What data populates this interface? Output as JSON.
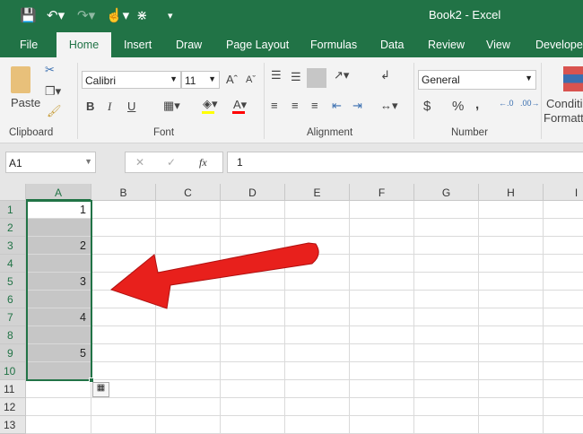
{
  "title": "Book2  -  Excel",
  "quick_access": {
    "save": "save-icon",
    "undo": "undo-icon",
    "redo": "redo-icon",
    "touch": "touch-mode-icon",
    "customize": "customize-icon"
  },
  "tabs": [
    "File",
    "Home",
    "Insert",
    "Draw",
    "Page Layout",
    "Formulas",
    "Data",
    "Review",
    "View",
    "Developer"
  ],
  "ribbon": {
    "paste": "Paste",
    "groups": [
      "Clipboard",
      "Font",
      "Alignment",
      "Number"
    ],
    "font_name": "Calibri",
    "font_size": "11",
    "number_format": "General",
    "bold": "B",
    "italic": "I",
    "underline": "U",
    "currency": "$",
    "percent": "%",
    "comma": ",",
    "conditional": "Conditi",
    "conditional2": "Formatt",
    "colors": {
      "highlight": "#ffff00",
      "font": "#ff0000"
    }
  },
  "formula_bar": {
    "name_box": "A1",
    "fx": "fx",
    "value": "1"
  },
  "columns": [
    "A",
    "B",
    "C",
    "D",
    "E",
    "F",
    "G",
    "H",
    "I"
  ],
  "rows": [
    "1",
    "2",
    "3",
    "4",
    "5",
    "6",
    "7",
    "8",
    "9",
    "10",
    "11",
    "12",
    "13"
  ],
  "cells_A": [
    "1",
    "",
    "2",
    "",
    "3",
    "",
    "4",
    "",
    "5",
    "",
    "",
    "",
    ""
  ],
  "colors": {
    "accent": "#217346",
    "arrow": "#e8201c",
    "selection": "#c6c6c6"
  }
}
